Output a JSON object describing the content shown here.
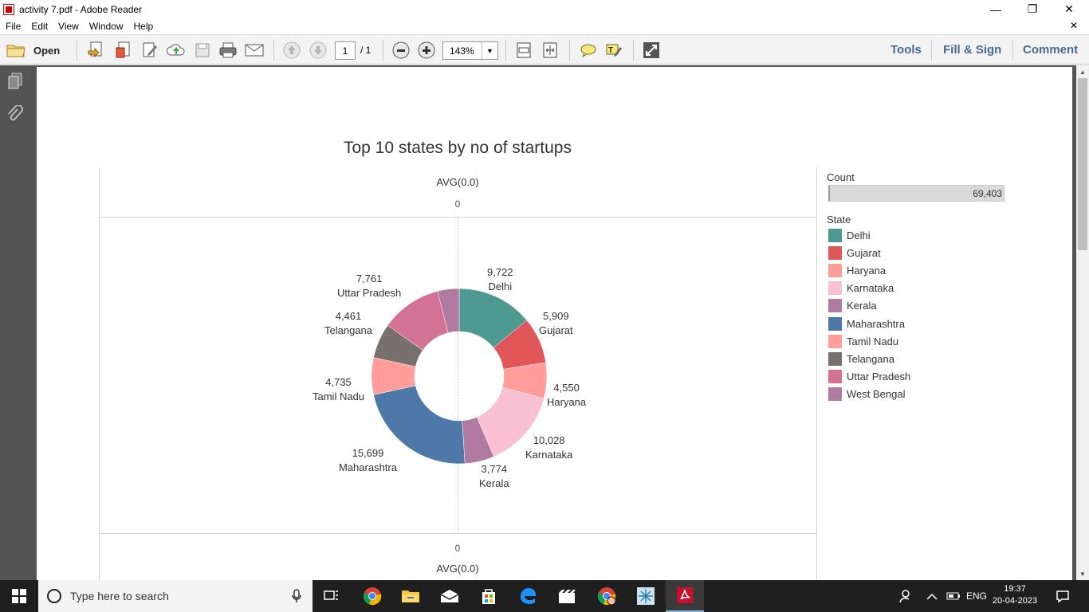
{
  "window": {
    "title": "activity 7.pdf - Adobe Reader",
    "minimize": "—",
    "restore": "❐",
    "close": "✕"
  },
  "menu": {
    "items": [
      "File",
      "Edit",
      "View",
      "Window",
      "Help"
    ],
    "close": "✕"
  },
  "toolbar": {
    "open_label": "Open",
    "page_current": "1",
    "page_total": "/ 1",
    "zoom": "143%",
    "right_tabs": [
      "Tools",
      "Fill & Sign",
      "Comment"
    ]
  },
  "chart": {
    "avg_label_top": "AVG(0.0)",
    "avg_zero_top": "0",
    "avg_label_bottom": "AVG(0.0)",
    "avg_zero_bottom": "0",
    "count_header": "Count",
    "count_value": "69,403",
    "state_header": "State"
  },
  "chart_data": {
    "type": "pie",
    "title": "Top 10 states by no of startups",
    "donut": true,
    "total": 69403,
    "slices": [
      {
        "label": "Delhi",
        "value": 9722,
        "display": "9,722",
        "color": "#4e9a91"
      },
      {
        "label": "Gujarat",
        "value": 5909,
        "display": "5,909",
        "color": "#e15759"
      },
      {
        "label": "Haryana",
        "value": 4550,
        "display": "4,550",
        "color": "#ff9d9a"
      },
      {
        "label": "Karnataka",
        "value": 10028,
        "display": "10,028",
        "color": "#f9c0d4"
      },
      {
        "label": "Kerala",
        "value": 3774,
        "display": "3,774",
        "color": "#b07aa1"
      },
      {
        "label": "Maharashtra",
        "value": 15699,
        "display": "15,699",
        "color": "#4e78a8"
      },
      {
        "label": "Tamil Nadu",
        "value": 4735,
        "display": "4,735",
        "color": "#ff9d9a"
      },
      {
        "label": "Telangana",
        "value": 4461,
        "display": "4,461",
        "color": "#79706e"
      },
      {
        "label": "Uttar Pradesh",
        "value": 7761,
        "display": "7,761",
        "color": "#d37295"
      },
      {
        "label": "West Bengal",
        "value": 2764,
        "display": "",
        "color": "#b07aa1"
      }
    ],
    "legend_placement": "right"
  },
  "taskbar": {
    "search_placeholder": "Type here to search",
    "lang": "ENG",
    "time": "19:37",
    "date": "20-04-2023"
  }
}
